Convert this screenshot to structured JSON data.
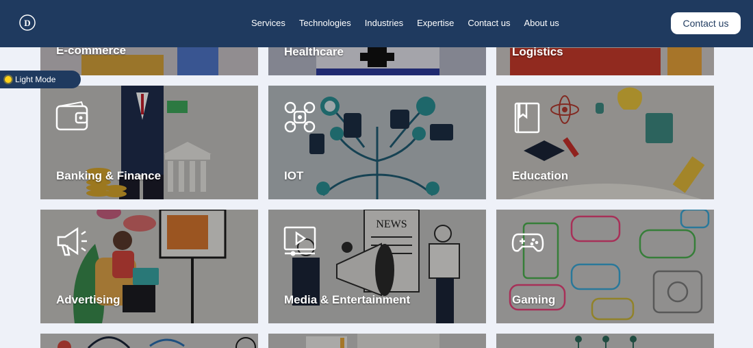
{
  "header": {
    "nav": [
      "Services",
      "Technologies",
      "Industries",
      "Expertise",
      "Contact us",
      "About us"
    ],
    "cta_label": "Contact us"
  },
  "mode_toggle": {
    "label": "Light Mode"
  },
  "industries": [
    {
      "label": "E-commerce",
      "icon": "shopping-icon"
    },
    {
      "label": "Healthcare",
      "icon": "medical-cross-icon"
    },
    {
      "label": "Logistics",
      "icon": "truck-icon"
    },
    {
      "label": "Banking & Finance",
      "icon": "wallet-icon"
    },
    {
      "label": "IOT",
      "icon": "drone-icon"
    },
    {
      "label": "Education",
      "icon": "book-icon"
    },
    {
      "label": "Advertising",
      "icon": "megaphone-icon"
    },
    {
      "label": "Media & Entertainment",
      "icon": "video-player-icon"
    },
    {
      "label": "Gaming",
      "icon": "gamepad-icon"
    }
  ]
}
